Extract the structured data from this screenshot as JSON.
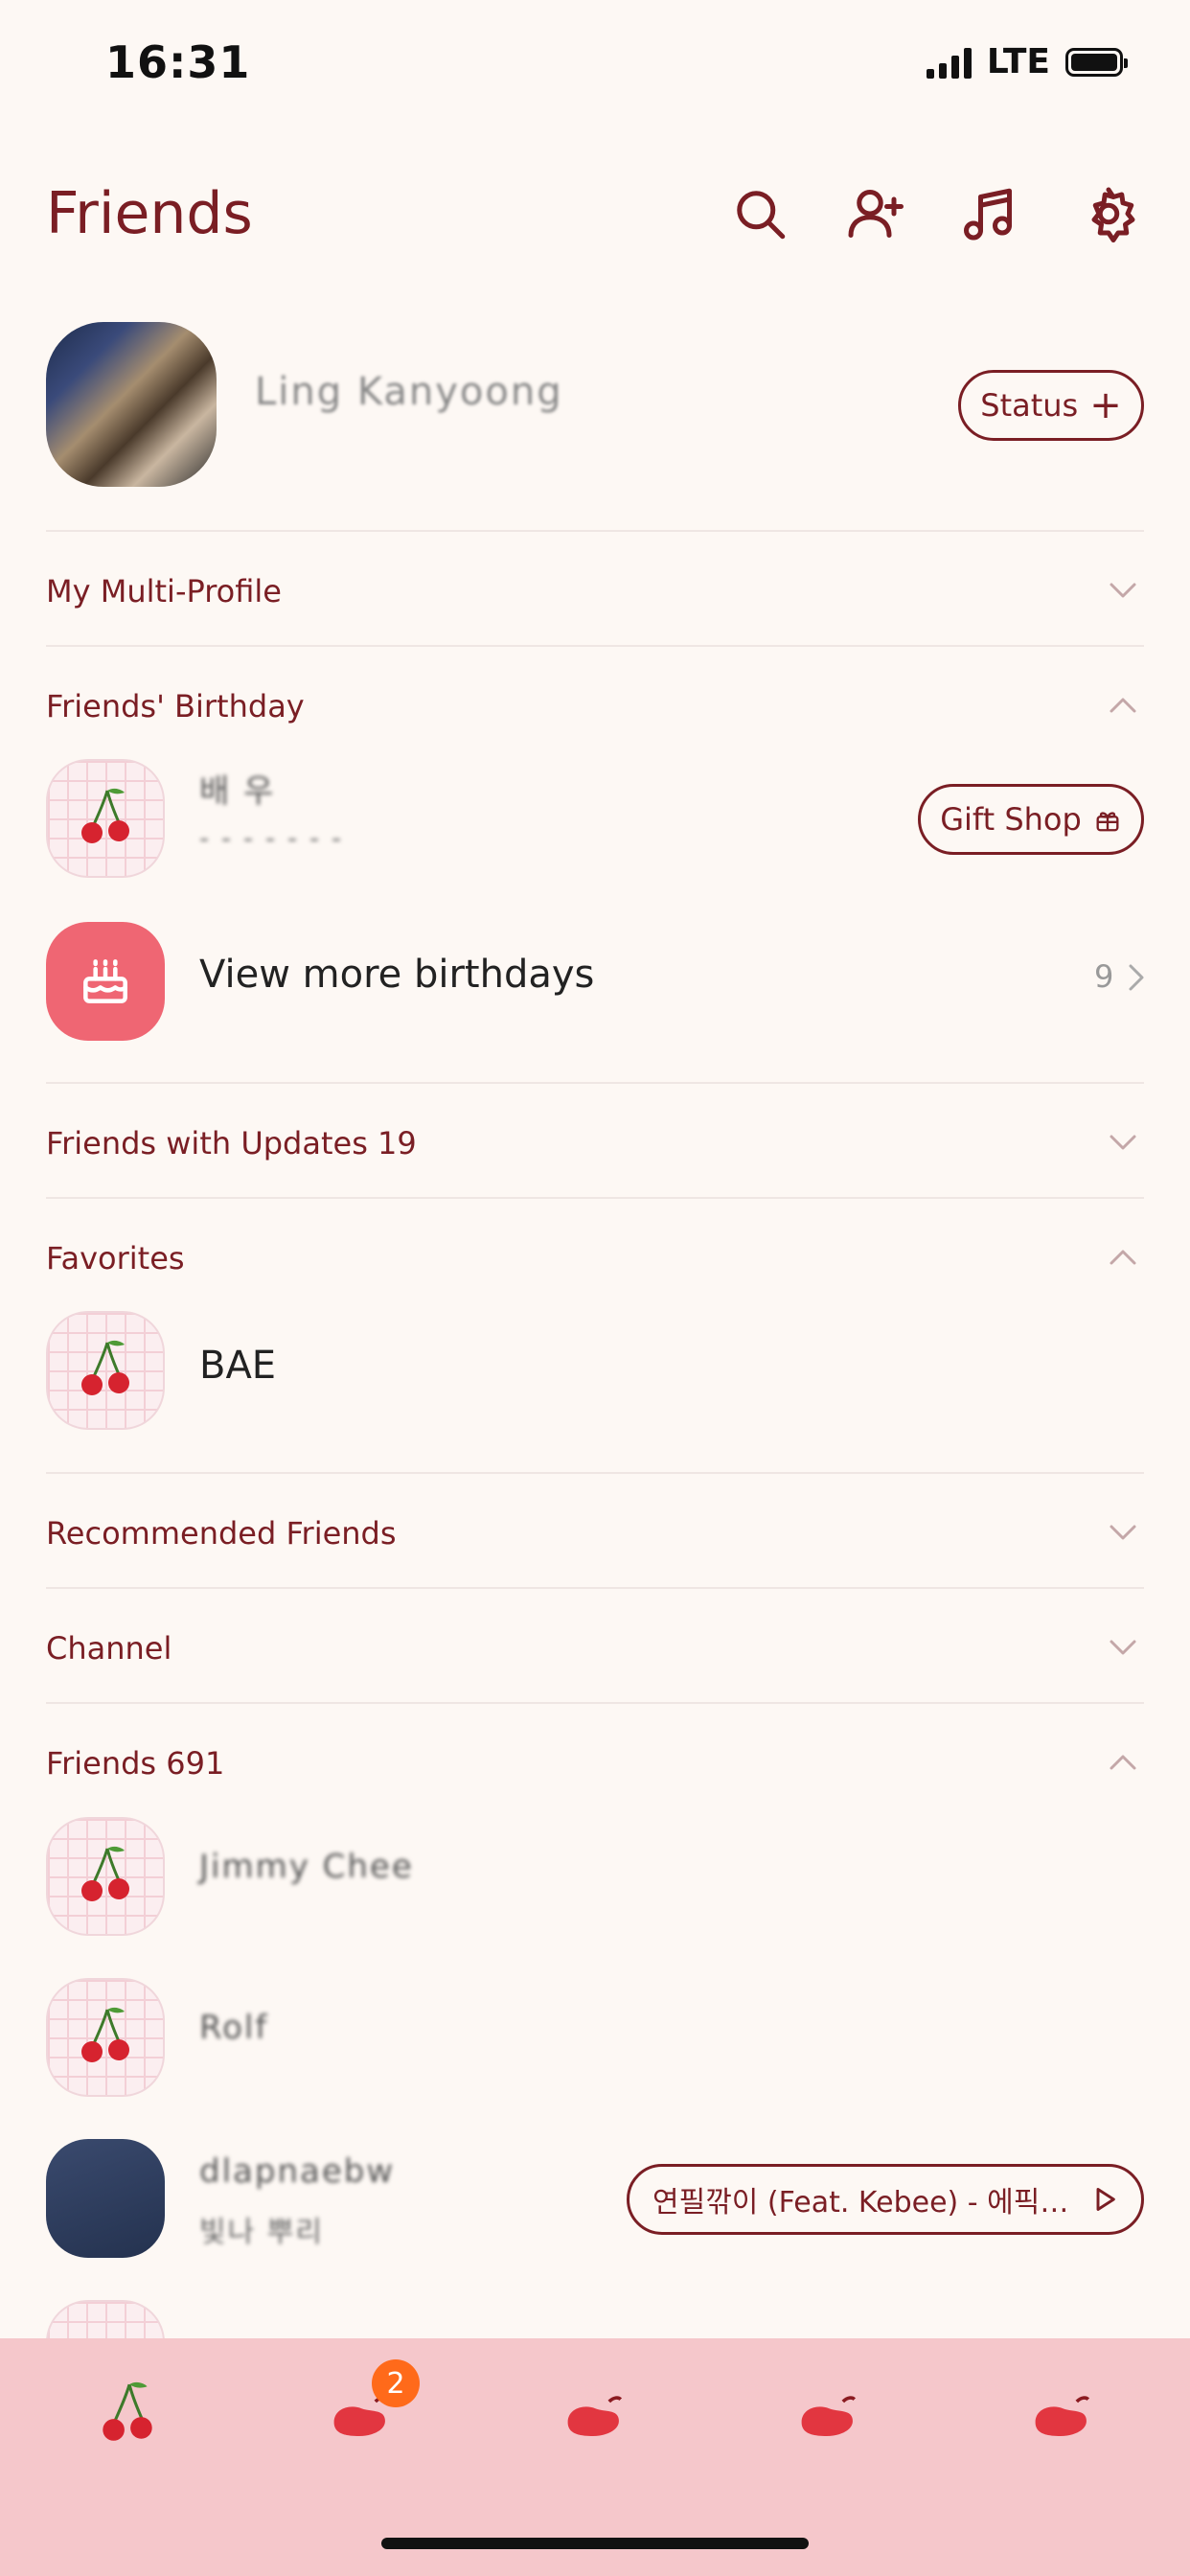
{
  "status_bar": {
    "time": "16:31",
    "network": "LTE"
  },
  "header": {
    "title": "Friends"
  },
  "profile": {
    "name": "Ling Kanyoong",
    "status_button": "Status"
  },
  "sections": {
    "multi_profile": "My Multi-Profile",
    "birthday": "Friends' Birthday",
    "updates": "Friends with Updates 19",
    "favorites": "Favorites",
    "recommended": "Recommended Friends",
    "channel": "Channel",
    "friends": "Friends 691"
  },
  "birthday": {
    "friend_name": "배 우",
    "friend_sub": "- - - - - - -",
    "gift_button": "Gift Shop",
    "view_more": "View more birthdays",
    "count": "9"
  },
  "favorites": {
    "items": [
      {
        "name": "BAE"
      }
    ]
  },
  "friends": {
    "items": [
      {
        "name": "Jimmy Chee"
      },
      {
        "name": "Rolf"
      },
      {
        "name": "dlapnaebw",
        "sub": "빛나 뿌리"
      }
    ],
    "music": "연필깎이 (Feat. Kebee) - 에픽…"
  },
  "tabbar": {
    "badge": "2"
  },
  "colors": {
    "accent": "#7a1e24",
    "tabbar": "#f5c7cb",
    "badge": "#ff6a1a",
    "cake": "#ef6673"
  }
}
